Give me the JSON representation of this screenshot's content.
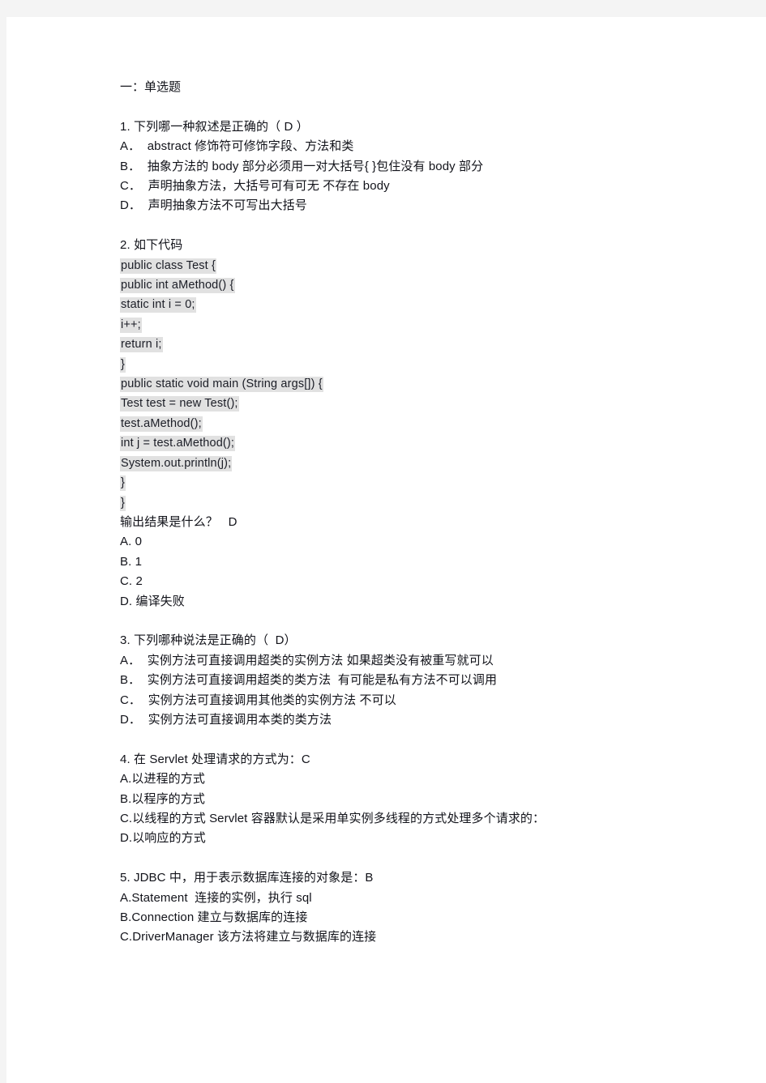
{
  "document": {
    "section_title": "一：单选题",
    "questions": [
      {
        "id": "q1",
        "stem": "1. 下列哪一种叙述是正确的（ D ）",
        "options": [
          "A．  abstract 修饰符可修饰字段、方法和类",
          "B．  抽象方法的 body 部分必须用一对大括号{ }包住没有 body 部分",
          "C．  声明抽象方法，大括号可有可无 不存在 body",
          "D．  声明抽象方法不可写出大括号"
        ]
      },
      {
        "id": "q2",
        "stem": "2. 如下代码",
        "code": [
          "public class Test {",
          "public int aMethod() {",
          "static int i = 0;",
          "i++;",
          "return i;",
          "}",
          "public static void main (String args[]) {",
          "Test test = new Test();",
          "test.aMethod();",
          "int j = test.aMethod();",
          "System.out.println(j);",
          "}",
          "}"
        ],
        "prompt": "输出结果是什么？   D",
        "options": [
          "A. 0",
          "B. 1",
          "C. 2",
          "D. 编译失败"
        ]
      },
      {
        "id": "q3",
        "stem": "3. 下列哪种说法是正确的（  D）",
        "options": [
          "A．  实例方法可直接调用超类的实例方法 如果超类没有被重写就可以",
          "B．  实例方法可直接调用超类的类方法  有可能是私有方法不可以调用",
          "C．  实例方法可直接调用其他类的实例方法 不可以",
          "D．  实例方法可直接调用本类的类方法"
        ]
      },
      {
        "id": "q4",
        "stem": "4. 在 Servlet 处理请求的方式为：C",
        "options": [
          "A.以进程的方式",
          "B.以程序的方式",
          "C.以线程的方式 Servlet 容器默认是采用单实例多线程的方式处理多个请求的：",
          "D.以响应的方式"
        ]
      },
      {
        "id": "q5",
        "stem": "5. JDBC 中，用于表示数据库连接的对象是：B",
        "options": [
          "A.Statement  连接的实例，执行 sql",
          "B.Connection 建立与数据库的连接",
          "C.DriverManager 该方法将建立与数据库的连接"
        ]
      }
    ]
  },
  "colors": {
    "page_background": "#ffffff",
    "outer_background": "#f4f4f4",
    "text": "#12131a",
    "code_highlight": "#e1e1e1"
  }
}
